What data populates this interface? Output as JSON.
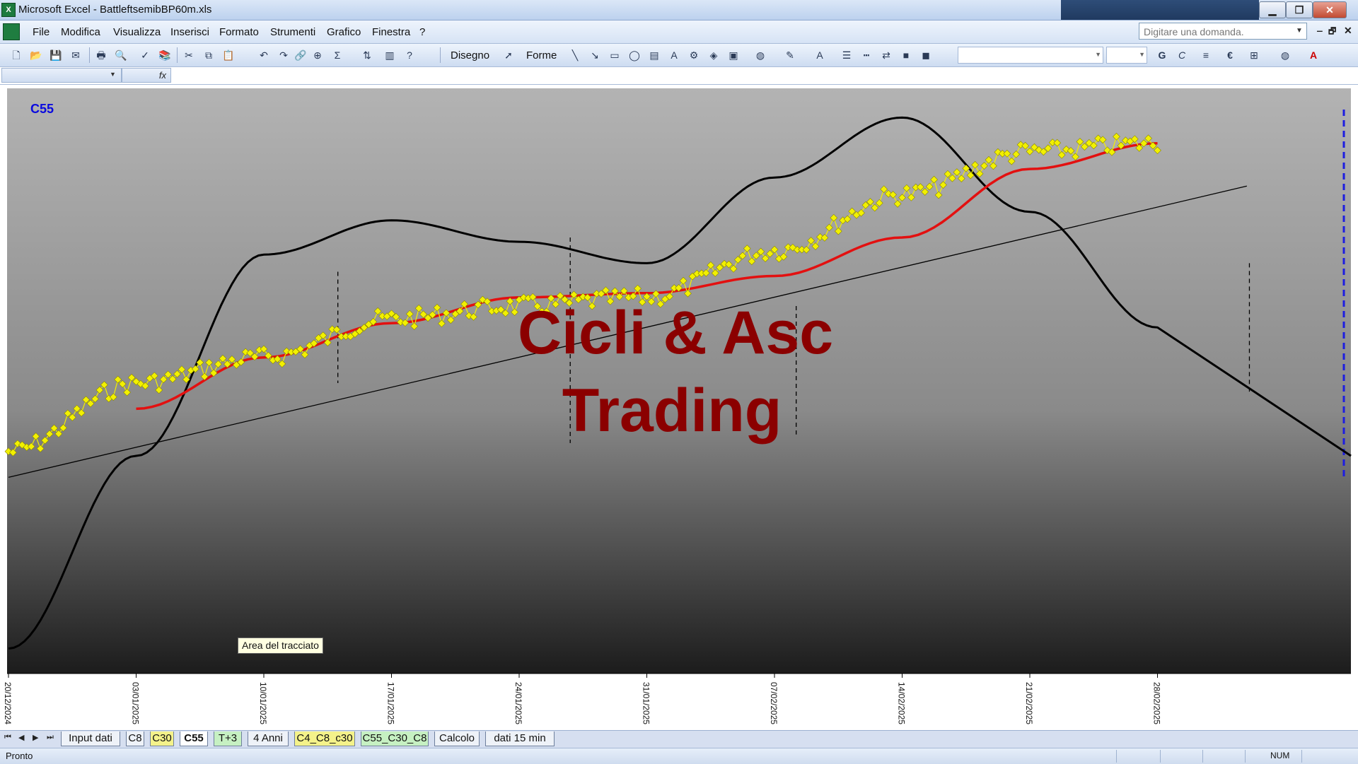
{
  "window": {
    "title": "Microsoft Excel - BattleftsemibBP60m.xls",
    "minimize": "▁",
    "restore": "❐",
    "close": "✕"
  },
  "menu": {
    "items": [
      "File",
      "Modifica",
      "Visualizza",
      "Inserisci",
      "Formato",
      "Strumenti",
      "Grafico",
      "Finestra",
      "?"
    ],
    "ask_placeholder": "Digitare una domanda.",
    "doc_minimize": "‒",
    "doc_restore": "🗗",
    "doc_close": "✕"
  },
  "toolbar": {
    "draw_label": "Disegno",
    "shapes_label": "Forme",
    "bold": "G",
    "italic": "C",
    "euro": "€"
  },
  "formula": {
    "fx": "fx"
  },
  "chart": {
    "label": "C55",
    "watermark_line1": "Cicli & Asc",
    "watermark_line2": "Trading",
    "tooltip": "Area del tracciato",
    "x_ticks": [
      "20/12/2024",
      "03/01/2025",
      "10/01/2025",
      "17/01/2025",
      "24/01/2025",
      "31/01/2025",
      "07/02/2025",
      "14/02/2025",
      "21/02/2025",
      "28/02/2025"
    ],
    "colors": {
      "price": "#f2f000",
      "ma": "#e31010",
      "cycle": "#000000",
      "trend": "#000000",
      "watermark": "#8b0000",
      "label": "#0a0adf"
    }
  },
  "chart_data": {
    "type": "line",
    "title": "C55",
    "x": [
      "20/12/2024",
      "03/01/2025",
      "10/01/2025",
      "17/01/2025",
      "24/01/2025",
      "31/01/2025",
      "07/02/2025",
      "14/02/2025",
      "21/02/2025",
      "28/02/2025"
    ],
    "series": [
      {
        "name": "",
        "values": [
          0.06,
          0.22,
          0.28,
          0.37,
          0.4,
          0.42,
          0.53,
          0.66,
          0.76,
          0.78
        ]
      },
      {
        "name": "",
        "values": [
          null,
          0.16,
          0.28,
          0.36,
          0.42,
          0.43,
          0.47,
          0.56,
          0.72,
          0.78
        ]
      },
      {
        "name": "",
        "values": [
          -0.4,
          0.05,
          0.52,
          0.6,
          0.55,
          0.5,
          0.7,
          0.84,
          0.62,
          0.35
        ]
      }
    ],
    "xlabel": "",
    "ylabel": "",
    "grid": false,
    "legend": "none"
  },
  "sheet_tabs": [
    {
      "label": "Input dati",
      "color": "#eef2f8"
    },
    {
      "label": "C8",
      "color": "#eef2f8"
    },
    {
      "label": "C30",
      "color": "#f4f28a"
    },
    {
      "label": "C55",
      "color": "#ffffff",
      "active": true
    },
    {
      "label": "T+3",
      "color": "#c6f0c2"
    },
    {
      "label": "4 Anni",
      "color": "#eef2f8"
    },
    {
      "label": "C4_C8_c30",
      "color": "#f4f28a"
    },
    {
      "label": "C55_C30_C8",
      "color": "#c6f0c2"
    },
    {
      "label": "Calcolo",
      "color": "#eef2f8"
    },
    {
      "label": "dati 15 min",
      "color": "#eef2f8"
    }
  ],
  "tab_nav": [
    "⏮",
    "◀",
    "▶",
    "⏭"
  ],
  "status": {
    "ready": "Pronto",
    "num": "NUM"
  }
}
